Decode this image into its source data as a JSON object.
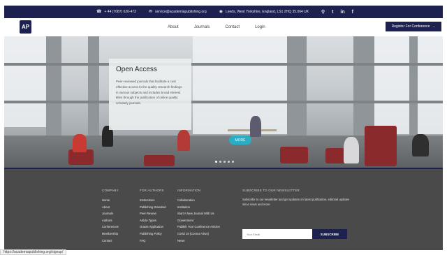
{
  "topbar": {
    "phone": "+ 44 (7087) 626-473",
    "email": "service@academiapublishing.org",
    "address": "Leeds, West Yorkshire, England, LS1 2HQ 35.064 UK",
    "icons": [
      "phone-icon",
      "mail-icon",
      "location-icon",
      "search-icon",
      "twitter-icon",
      "linkedin-icon",
      "facebook-icon"
    ]
  },
  "nav": {
    "logo": "AP",
    "links": [
      "About",
      "Journals",
      "Contact",
      "Login"
    ],
    "register": "Register For Conference",
    "register_icon": "→"
  },
  "hero": {
    "title": "Open Access",
    "body": "Peer-reviewed journals that facilitate a cost effective access to the quality research findings in various subjects and includes broad interest titles through the publication of online quality scholarly journals.",
    "button": "MORE",
    "slides": 5,
    "active_slide": 0
  },
  "footer": {
    "company": {
      "heading": "COMPANY",
      "items": [
        "Home",
        "About",
        "Journals",
        "Authors",
        "Conferences",
        "Membership",
        "Contact"
      ]
    },
    "for_authors": {
      "heading": "FOR AUTHORS",
      "items": [
        "Instructions",
        "Publishing Standard",
        "Peer Review",
        "Article Types",
        "Grants Application",
        "Publishing Policy",
        "FAQ"
      ]
    },
    "information": {
      "heading": "INFORMATION",
      "items": [
        "Collaboration",
        "Institution",
        "Start A New Journal With Us",
        "Government",
        "Publish Your Conference Articles",
        "Covid 19 (Corona Virus)",
        "News"
      ]
    },
    "newsletter": {
      "heading": "SUBSCRIBE TO OUR NEWSLETTER",
      "text": "Subscribe to our newsletter and get updates on latest publication, editorial updates since news and more",
      "placeholder": "Your Email",
      "button": "SUBSCRIBE"
    }
  },
  "status": {
    "url": "https://academiapublishing.org/signup/"
  },
  "colors": {
    "navy": "#1d2150",
    "teal": "#2aaec3",
    "footer_bg": "#4a4a4b"
  }
}
